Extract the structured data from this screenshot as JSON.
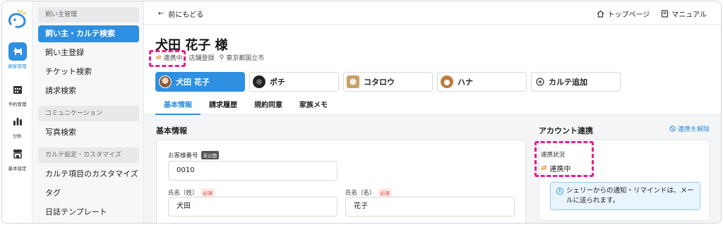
{
  "rail": {
    "items": [
      {
        "label": "顧客管理",
        "icon": "dog-icon",
        "active": true
      },
      {
        "label": "予約管理",
        "icon": "calendar-icon",
        "active": false
      },
      {
        "label": "分析",
        "icon": "bar-chart-icon",
        "active": false
      },
      {
        "label": "基本設定",
        "icon": "store-icon",
        "active": false
      }
    ]
  },
  "subnav": {
    "sections": [
      {
        "heading": "飼い主管理",
        "items": [
          "飼い主・カルテ検索",
          "飼い主登録",
          "チケット検索",
          "請求検索"
        ]
      },
      {
        "heading": "コミュニケーション",
        "items": [
          "写真検索"
        ]
      },
      {
        "heading": "カルテ設定・カスタマイズ",
        "items": [
          "カルテ項目のカスタマイズ",
          "タグ",
          "日誌テンプレート"
        ]
      }
    ],
    "active_item": "飼い主・カルテ検索"
  },
  "topbar": {
    "back_label": "前にもどる",
    "top_page_label": "トップページ",
    "manual_label": "マニュアル"
  },
  "customer": {
    "title": "犬田 花子 様",
    "link_status": "連携中",
    "registration": "店舗登録",
    "location": "東京都国立市"
  },
  "pets": [
    {
      "label": "犬田 花子",
      "active": true
    },
    {
      "label": "ポチ",
      "active": false
    },
    {
      "label": "コタロウ",
      "active": false
    },
    {
      "label": "ハナ",
      "active": false
    },
    {
      "label": "カルテ追加",
      "active": false
    }
  ],
  "tabs": [
    "基本情報",
    "請求履歴",
    "規約同意",
    "家族メモ"
  ],
  "basic_info": {
    "heading": "基本情報",
    "customer_number_label": "お客様番号",
    "private_badge": "非公開",
    "customer_number": "0010",
    "last_name_label": "氏名（姓）",
    "first_name_label": "氏名（名）",
    "required_badge": "必須",
    "last_name": "犬田",
    "first_name": "花子"
  },
  "account": {
    "heading": "アカウント連携",
    "unlink_label": "連携を解除",
    "status_label": "連携状況",
    "status_value": "連携中",
    "notice_line1": "シェリーからの通知・リマインドは、メー",
    "notice_line2": "ルに送られます。"
  },
  "colors": {
    "accent": "#2f8fe0",
    "highlight": "#e91e8c",
    "link_swap": "#e8912d"
  }
}
